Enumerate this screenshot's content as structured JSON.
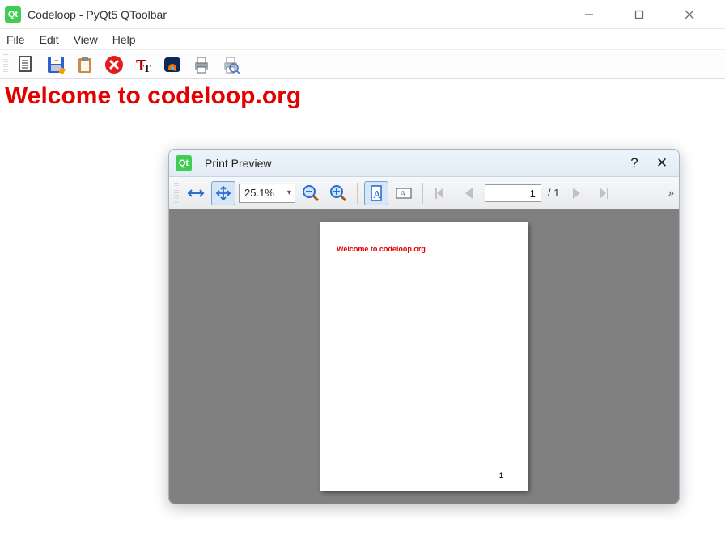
{
  "window": {
    "title": "Codeloop - PyQt5 QToolbar",
    "logo_text": "Qt"
  },
  "menubar": [
    "File",
    "Edit",
    "View",
    "Help"
  ],
  "toolbar_icons": [
    "copy-icon",
    "save-icon",
    "paste-icon",
    "close-icon",
    "font-icon",
    "color-icon",
    "print-icon",
    "print-preview-icon"
  ],
  "content": {
    "heading": "Welcome to codeloop.org"
  },
  "dialog": {
    "title": "Print Preview",
    "logo_text": "Qt",
    "help": "?",
    "close": "✕",
    "zoom_value": "25.1%",
    "page_input": "1",
    "page_total": "/ 1",
    "expand": "»",
    "preview_text": "Welcome to codeloop.org",
    "preview_page_number": "1"
  }
}
